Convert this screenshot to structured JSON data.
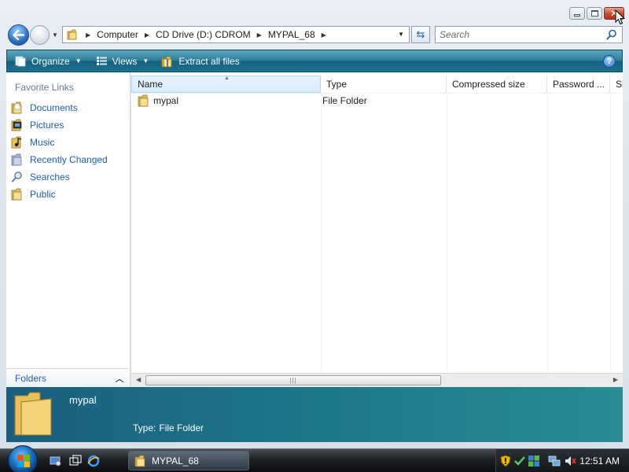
{
  "window": {
    "address": {
      "crumbs": [
        "Computer",
        "CD Drive (D:) CDROM",
        "MYPAL_68"
      ]
    },
    "search": {
      "placeholder": "Search"
    }
  },
  "commandbar": {
    "organize": "Organize",
    "views": "Views",
    "extract": "Extract all files"
  },
  "navpane": {
    "title": "Favorite Links",
    "items": [
      {
        "label": "Documents",
        "icon": "documents-icon"
      },
      {
        "label": "Pictures",
        "icon": "pictures-icon"
      },
      {
        "label": "Music",
        "icon": "music-icon"
      },
      {
        "label": "Recently Changed",
        "icon": "recently-changed-icon"
      },
      {
        "label": "Searches",
        "icon": "searches-icon"
      },
      {
        "label": "Public",
        "icon": "public-icon"
      }
    ],
    "folders_label": "Folders"
  },
  "filelist": {
    "columns": [
      "Name",
      "Type",
      "Compressed size",
      "Password ...",
      "Si"
    ],
    "rows": [
      {
        "name": "mypal",
        "type": "File Folder"
      }
    ]
  },
  "details": {
    "name": "mypal",
    "type_key": "Type:",
    "type_value": "File Folder"
  },
  "taskbar": {
    "task_label": "MYPAL_68",
    "clock": "12:51 AM"
  },
  "colors": {
    "command_bar": "#2b7d99",
    "link_blue": "#1e5fb3",
    "details_pane": "#1d7488",
    "folder_yellow": "#e8c15a"
  }
}
